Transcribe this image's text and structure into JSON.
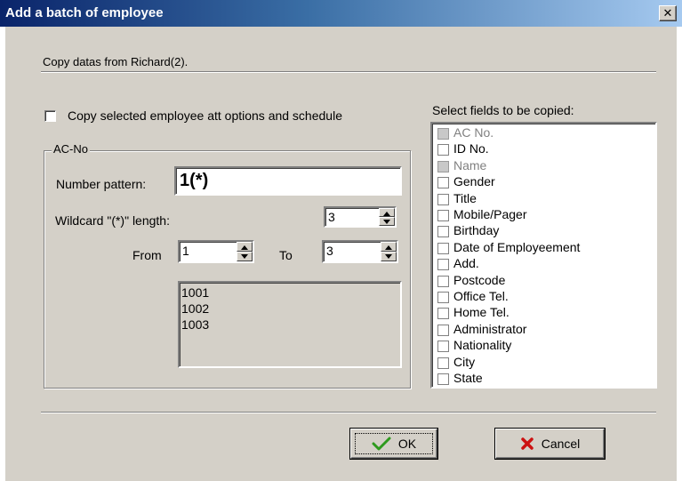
{
  "window": {
    "title": "Add a batch of employee",
    "close_symbol": "✕"
  },
  "header": {
    "copy_text": "Copy datas from Richard(2)."
  },
  "copy_options": {
    "label": "Copy selected employee att options and schedule",
    "checked": false
  },
  "ac_no_group": {
    "legend": "AC-No",
    "number_pattern_label": "Number pattern:",
    "number_pattern_value": "1(*)",
    "wildcard_label": "Wildcard \"(*)\" length:",
    "wildcard_value": "3",
    "from_label": "From",
    "from_value": "1",
    "to_label": "To",
    "to_value": "3",
    "preview": [
      "1001",
      "1002",
      "1003"
    ]
  },
  "fields_panel": {
    "label": "Select fields to be copied:",
    "items": [
      {
        "label": "AC No.",
        "checked": false,
        "disabled": true
      },
      {
        "label": "ID No.",
        "checked": false,
        "disabled": false
      },
      {
        "label": "Name",
        "checked": false,
        "disabled": true
      },
      {
        "label": "Gender",
        "checked": false,
        "disabled": false
      },
      {
        "label": "Title",
        "checked": false,
        "disabled": false
      },
      {
        "label": "Mobile/Pager",
        "checked": false,
        "disabled": false
      },
      {
        "label": "Birthday",
        "checked": false,
        "disabled": false
      },
      {
        "label": "Date of Employeement",
        "checked": false,
        "disabled": false
      },
      {
        "label": "Add.",
        "checked": false,
        "disabled": false
      },
      {
        "label": "Postcode",
        "checked": false,
        "disabled": false
      },
      {
        "label": "Office Tel.",
        "checked": false,
        "disabled": false
      },
      {
        "label": "Home Tel.",
        "checked": false,
        "disabled": false
      },
      {
        "label": "Administrator",
        "checked": false,
        "disabled": false
      },
      {
        "label": "Nationality",
        "checked": false,
        "disabled": false
      },
      {
        "label": "City",
        "checked": false,
        "disabled": false
      },
      {
        "label": "State",
        "checked": false,
        "disabled": false
      }
    ]
  },
  "buttons": {
    "ok_label": "OK",
    "cancel_label": "Cancel"
  },
  "icons": {
    "ok_icon": "checkmark-icon",
    "cancel_icon": "red-x-icon",
    "close_icon": "close-icon"
  },
  "colors": {
    "titlebar_start": "#0a246a",
    "titlebar_end": "#a6caf0",
    "ok_check": "#2e9a1e",
    "cancel_x": "#cc1111"
  }
}
